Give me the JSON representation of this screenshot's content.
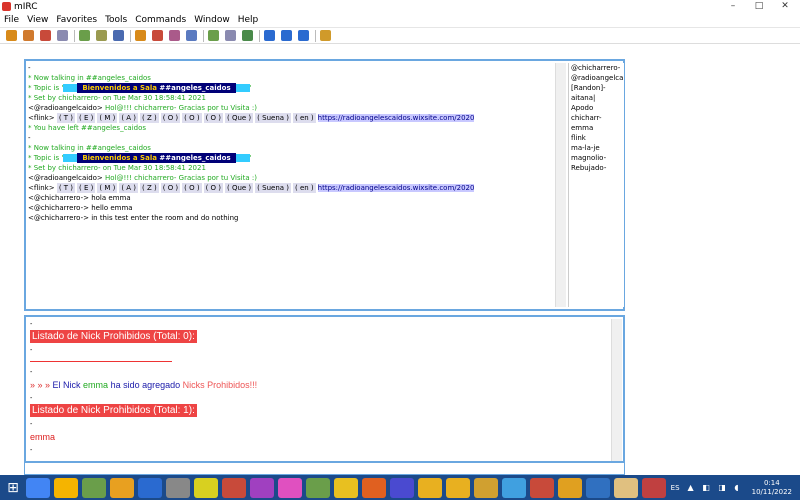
{
  "window": {
    "title": "mIRC"
  },
  "menu": [
    "File",
    "View",
    "Favorites",
    "Tools",
    "Commands",
    "Window",
    "Help"
  ],
  "toolbar_icon_colors": [
    "#d88a1a",
    "#d07a2e",
    "#c84a3a",
    "#8a8ab0",
    "#6a9e4a",
    "#9a9a50",
    "#4a6ab0",
    "#d88a1a",
    "#c84a3a",
    "#aa5a8a",
    "#5a7ac0",
    "#6a9e4a",
    "#8a8ab0",
    "#4a8a4a",
    "#2a6ad0",
    "#2a6ad0",
    "#2a6ad0",
    "#d09a2a"
  ],
  "channel": {
    "lines": [
      {
        "text": "-",
        "style": "plain"
      },
      {
        "text": "* Now talking in ##angeles_caidos",
        "style": "green"
      },
      {
        "type": "topic",
        "prefix": "* Topic is '",
        "banner": "Bienvenidos a Sala ",
        "channel": "##angeles_caidos",
        "suffix": "'"
      },
      {
        "text": "* Set by chicharrero- on Tue Mar 30 18:58:41 2021",
        "style": "green"
      },
      {
        "type": "greet",
        "nick": "<@radioangelcaido>",
        "text": "Hol@!!! chicharrero-  Gracias por tu Visita :)"
      },
      {
        "type": "flink",
        "nick": "<flink>",
        "letters": [
          "( T )",
          "( E )",
          "( M )",
          "( A )",
          "( Z )",
          "( O )",
          "( O )",
          "( O )",
          "( Que )",
          "( Suena )",
          "( en )"
        ],
        "url": "https://radioangelescaidos.wixsite.com/2020"
      },
      {
        "text": "* You have left ##angeles_caidos",
        "style": "green"
      },
      {
        "text": "-",
        "style": "plain"
      },
      {
        "text": "* Now talking in ##angeles_caidos",
        "style": "green"
      },
      {
        "type": "topic",
        "prefix": "* Topic is '",
        "banner": "Bienvenidos a Sala ",
        "channel": "##angeles_caidos",
        "suffix": "'"
      },
      {
        "text": "* Set by chicharrero- on Tue Mar 30 18:58:41 2021",
        "style": "green"
      },
      {
        "type": "greet",
        "nick": "<@radioangelcaido>",
        "text": "Hol@!!! chicharrero-  Gracias por tu Visita :)"
      },
      {
        "type": "flink",
        "nick": "<flink>",
        "letters": [
          "( T )",
          "( E )",
          "( M )",
          "( A )",
          "( Z )",
          "( O )",
          "( O )",
          "( O )",
          "( Que )",
          "( Suena )",
          "( en )"
        ],
        "url": "https://radioangelescaidos.wixsite.com/2020"
      },
      {
        "text": "<@chicharrero-> hola emma",
        "style": "plain"
      },
      {
        "text": "<@chicharrero-> hello emma",
        "style": "plain"
      },
      {
        "text": "<@chicharrero-> in this test enter the room and do nothing",
        "style": "plain"
      }
    ],
    "nicks": [
      "@chicharrero-",
      "@radioangelcaido",
      "[Randon]-",
      "aitana|",
      "Apodo",
      "chicharr-",
      "emma",
      "flink",
      "ma-la-je",
      "magnolio-",
      "Rebujado-"
    ]
  },
  "status": {
    "lines": [
      {
        "type": "plain",
        "text": "-"
      },
      {
        "type": "header",
        "text": "Listado de Nick Prohibidos (Total: 0):"
      },
      {
        "type": "plain",
        "text": "-"
      },
      {
        "type": "rule"
      },
      {
        "type": "plain",
        "text": "-"
      },
      {
        "type": "added",
        "arrows": "» » »",
        "label": "El Nick",
        "nick": "emma",
        "mid": "ha sido agregado",
        "list": "Nicks Prohibidos!!!"
      },
      {
        "type": "plain",
        "text": "-"
      },
      {
        "type": "header",
        "text": "Listado de Nick Prohibidos (Total: 1):"
      },
      {
        "type": "plain",
        "text": "-"
      },
      {
        "type": "red",
        "text": "emma"
      },
      {
        "type": "plain",
        "text": "-"
      },
      {
        "type": "rule"
      },
      {
        "type": "plain",
        "text": "-"
      }
    ]
  },
  "taskbar": {
    "start_label": "⊞",
    "item_colors": [
      "#4285f4",
      "#f5b400",
      "#6a9e4a",
      "#e8a020",
      "#2a6ad0",
      "#888888",
      "#d8d020",
      "#c84a3a",
      "#a040c0",
      "#e050c0",
      "#6a9e4a",
      "#e8c020",
      "#e06020",
      "#4a4ad0",
      "#e8b020",
      "#e8b020",
      "#d0a030",
      "#40a0e0",
      "#c84a3a",
      "#e0a020",
      "#3070c0",
      "#e0c080",
      "#c04040"
    ],
    "lang": "ES",
    "tray_icons": "▲ ◧ ◨ ◖",
    "time": "0:14",
    "date": "10/11/2022"
  }
}
